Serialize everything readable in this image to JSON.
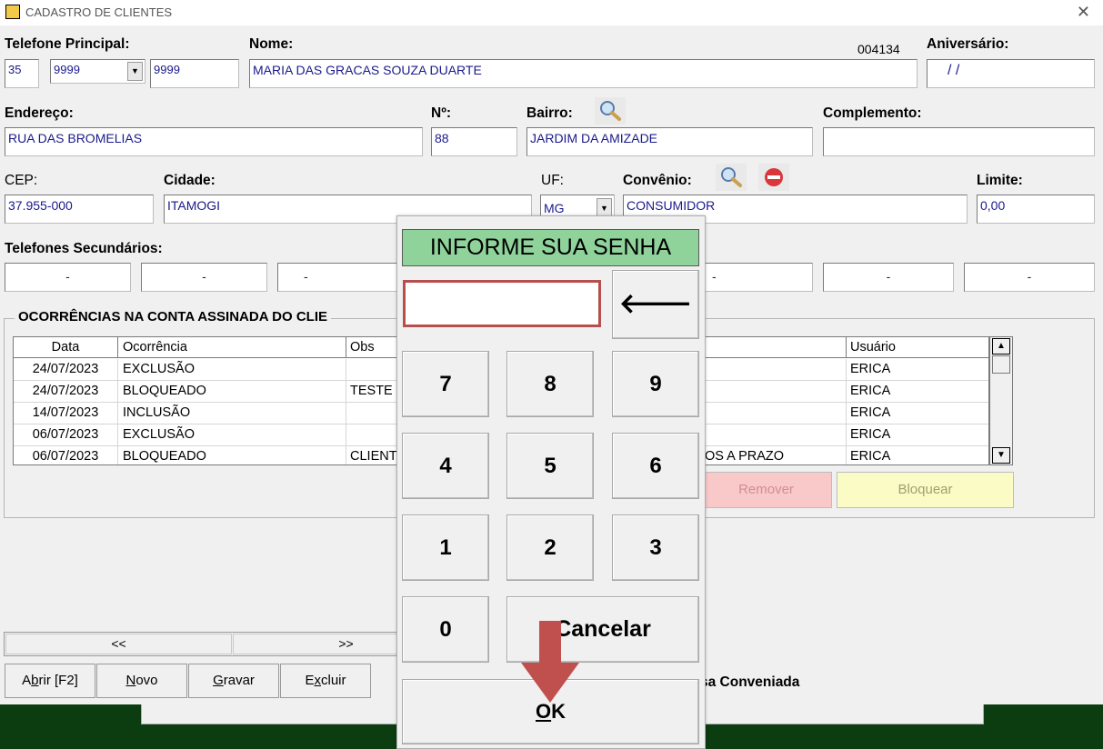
{
  "window": {
    "title": "CADASTRO DE CLIENTES",
    "code": "004134"
  },
  "labels": {
    "telefone_principal": "Telefone Principal:",
    "nome": "Nome:",
    "aniversario": "Aniversário:",
    "endereco": "Endereço:",
    "numero": "Nº:",
    "bairro": "Bairro:",
    "complemento": "Complemento:",
    "cep": "CEP:",
    "cidade": "Cidade:",
    "uf": "UF:",
    "convenio": "Convênio:",
    "limite": "Limite:",
    "telefones_secundarios": "Telefones Secundários:",
    "empresa_conveniada": "sa Conveniada"
  },
  "fields": {
    "ddd": "35",
    "prefixo": "9999",
    "sufixo": "9999",
    "nome": "MARIA DAS GRACAS SOUZA DUARTE",
    "aniversario": "/ /",
    "endereco": "RUA DAS BROMELIAS",
    "numero": "88",
    "bairro": "JARDIM DA AMIZADE",
    "complemento": "",
    "cep": "37.955-000",
    "cidade": "ITAMOGI",
    "uf": "MG",
    "convenio": "CONSUMIDOR",
    "limite": "0,00",
    "sec1": "-",
    "sec2": "-",
    "sec3": "-",
    "sec4": "-",
    "sec5": "-",
    "sec6": "-"
  },
  "ocorrencias": {
    "title": "OCORRÊNCIAS NA CONTA ASSINADA DO CLIE",
    "columns": [
      "Data",
      "Ocorrência",
      "Obs",
      "Usuário"
    ],
    "rows": [
      {
        "data": "24/07/2023",
        "ocorrencia": "EXCLUSÃO",
        "obs": "",
        "obs_tail": "",
        "usuario": "ERICA"
      },
      {
        "data": "24/07/2023",
        "ocorrencia": "BLOQUEADO",
        "obs": "TESTE",
        "obs_tail": "",
        "usuario": "ERICA"
      },
      {
        "data": "14/07/2023",
        "ocorrencia": "INCLUSÃO",
        "obs": "",
        "obs_tail": "",
        "usuario": "ERICA"
      },
      {
        "data": "06/07/2023",
        "ocorrencia": "EXCLUSÃO",
        "obs": "",
        "obs_tail": "",
        "usuario": "ERICA"
      },
      {
        "data": "06/07/2023",
        "ocorrencia": "BLOQUEADO",
        "obs": "CLIENT",
        "obs_tail": "OS A PRAZO",
        "usuario": "ERICA"
      }
    ],
    "remover_label": "Remover",
    "bloquear_label": "Bloquear"
  },
  "nav": {
    "prev": "<<",
    "next": ">>"
  },
  "toolbar": {
    "abrir_pre": "A",
    "abrir_u": "b",
    "abrir_post": "rir [F2]",
    "novo_u": "N",
    "novo_post": "ovo",
    "gravar_u": "G",
    "gravar_post": "ravar",
    "excluir_pre": "E",
    "excluir_u": "x",
    "excluir_post": "cluir"
  },
  "dialog": {
    "title": "INFORME SUA SENHA",
    "password": "",
    "backspace": "🡐",
    "keys": [
      "7",
      "8",
      "9",
      "4",
      "5",
      "6",
      "1",
      "2",
      "3",
      "0"
    ],
    "cancel": "Cancelar",
    "ok_u": "O",
    "ok_post": "K"
  },
  "colors": {
    "dialog_title_bg": "#8fd39b",
    "password_border": "#b5504e",
    "arrow": "#c0504d",
    "field_text": "#1a1a8c",
    "bottom_bar": "#0b3d10"
  }
}
